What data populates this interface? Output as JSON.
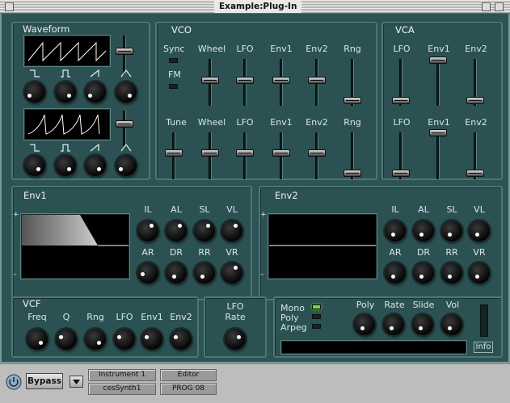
{
  "window": {
    "title": "Example:Plug-In"
  },
  "waveform": {
    "title": "Waveform",
    "labels": [
      "⌐¬",
      "⌐¬",
      "⌐¬",
      "⌐¬"
    ]
  },
  "vco": {
    "title": "VCO",
    "sync": "Sync",
    "fm": "FM",
    "row1": [
      "Wheel",
      "LFO",
      "Env1",
      "Env2",
      "Rng"
    ],
    "row2": [
      "Tune",
      "Wheel",
      "LFO",
      "Env1",
      "Env2",
      "Rng"
    ]
  },
  "vca": {
    "title": "VCA",
    "row1": [
      "LFO",
      "Env1",
      "Env2"
    ],
    "row2": [
      "LFO",
      "Env1",
      "Env2"
    ]
  },
  "env1": {
    "title": "Env1",
    "row1": [
      "IL",
      "AL",
      "SL",
      "VL"
    ],
    "row2": [
      "AR",
      "DR",
      "RR",
      "VR"
    ],
    "plus": "+",
    "minus": "–"
  },
  "env2": {
    "title": "Env2",
    "row1": [
      "IL",
      "AL",
      "SL",
      "VL"
    ],
    "row2": [
      "AR",
      "DR",
      "RR",
      "VR"
    ],
    "plus": "+",
    "minus": "–"
  },
  "vcf": {
    "title": "VCF",
    "labels": [
      "Freq",
      "Q",
      "Rng",
      "LFO",
      "Env1",
      "Env2"
    ]
  },
  "lfo": {
    "title": "LFO",
    "rate": "Rate"
  },
  "mode": {
    "mono": "Mono",
    "poly": "Poly",
    "arpeg": "Arpeg",
    "knobs": [
      "Poly",
      "Rate",
      "Slide",
      "Vol"
    ],
    "info": "Info"
  },
  "bottom": {
    "bypass": "Bypass",
    "instrument": "Instrument 1",
    "synth": "cesSynth1",
    "editor": "Editor",
    "prog": "PROG 08"
  }
}
